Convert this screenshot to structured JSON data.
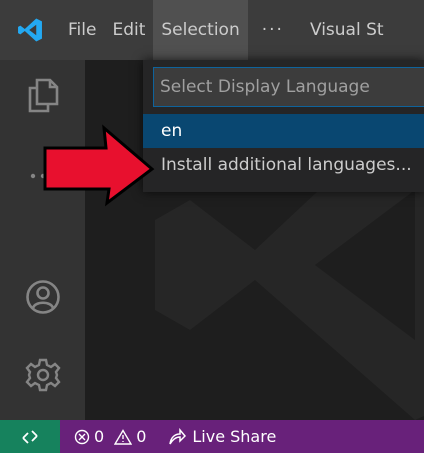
{
  "titlebar": {
    "menus": [
      "File",
      "Edit",
      "Selection"
    ],
    "more_label": "···",
    "window_title": "Visual St"
  },
  "quickpick": {
    "placeholder": "Select Display Language",
    "items": [
      {
        "label": "en",
        "selected": true
      },
      {
        "label": "Install additional languages...",
        "selected": false
      }
    ]
  },
  "statusbar": {
    "errors": "0",
    "warnings": "0",
    "live_share_label": "Live Share"
  },
  "activitybar": {
    "icons": [
      "explorer-icon",
      "more-icon",
      "account-icon",
      "settings-gear-icon"
    ]
  },
  "colors": {
    "titlebar_bg": "#3c3c3c",
    "activitybar_bg": "#333333",
    "editor_bg": "#1e1e1e",
    "statusbar_bg": "#68217a",
    "remote_bg": "#16825d",
    "selection_bg": "#094771",
    "focus_border": "#0e639c",
    "annotation_arrow": "#e8102e",
    "vscode_blue": "#23a9f2"
  }
}
